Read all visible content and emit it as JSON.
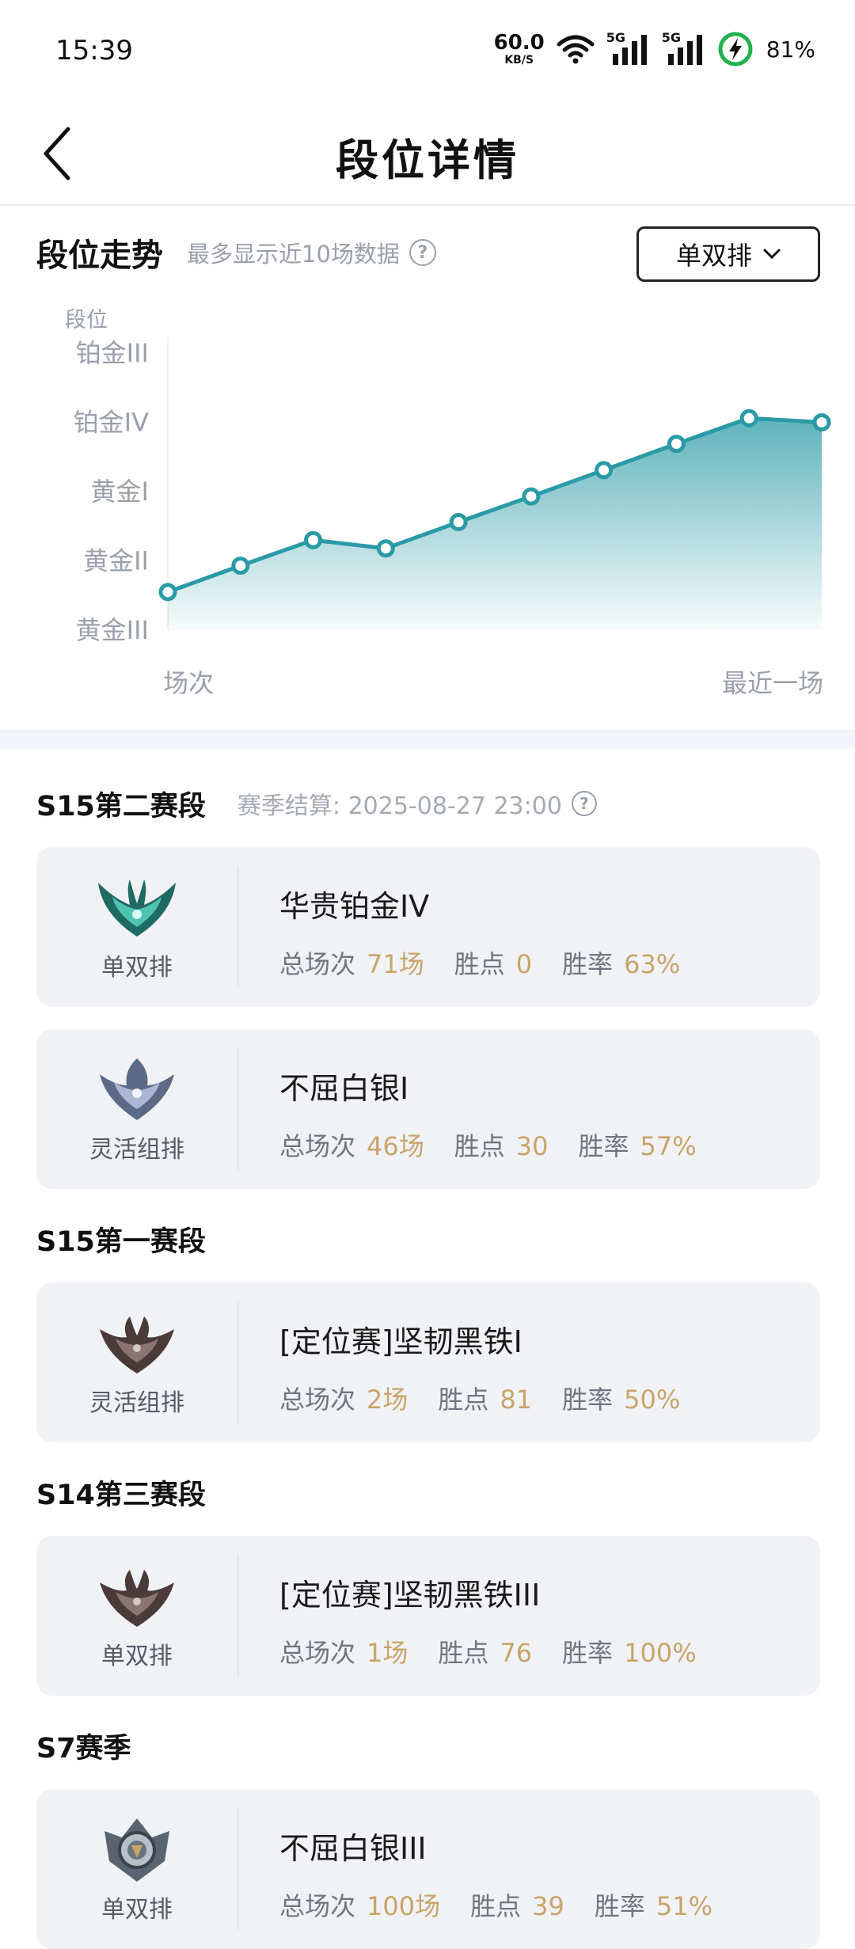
{
  "status_bar": {
    "time": "15:39",
    "net_speed_value": "60.0",
    "net_speed_unit": "KB/S",
    "signal_1_label": "5G",
    "signal_2_label": "5G",
    "battery_percent": "81%"
  },
  "nav": {
    "title": "段位详情"
  },
  "trend": {
    "title": "段位走势",
    "hint": "最多显示近10场数据",
    "help": "?",
    "queue_selected": "单双排"
  },
  "chart_data": {
    "type": "area",
    "ylabel": "段位",
    "xlabel_start": "场次",
    "xlabel_end": "最近一场",
    "y_ticks": [
      "黄金III",
      "黄金II",
      "黄金I",
      "铂金IV",
      "铂金III"
    ],
    "ylim": [
      0,
      4
    ],
    "x": [
      1,
      2,
      3,
      4,
      5,
      6,
      7,
      8,
      9,
      10
    ],
    "values": [
      0.55,
      0.93,
      1.3,
      1.18,
      1.56,
      1.93,
      2.31,
      2.69,
      3.06,
      3.0
    ],
    "color": "#2a9aa6",
    "grid": false
  },
  "seasons": [
    {
      "name": "S15第二赛段",
      "settle_text": "赛季结算: 2025-08-27 23:00",
      "help": "?",
      "ranks": [
        {
          "queue": "单双排",
          "rank": "华贵铂金IV",
          "games_label": "总场次",
          "games": "71场",
          "lp_label": "胜点",
          "lp": "0",
          "wr_label": "胜率",
          "wr": "63%",
          "emblem": "platinum-emblem-icon"
        },
        {
          "queue": "灵活组排",
          "rank": "不屈白银I",
          "games_label": "总场次",
          "games": "46场",
          "lp_label": "胜点",
          "lp": "30",
          "wr_label": "胜率",
          "wr": "57%",
          "emblem": "silver-emblem-icon"
        }
      ]
    },
    {
      "name": "S15第一赛段",
      "ranks": [
        {
          "queue": "灵活组排",
          "rank": "[定位赛]坚韧黑铁I",
          "games_label": "总场次",
          "games": "2场",
          "lp_label": "胜点",
          "lp": "81",
          "wr_label": "胜率",
          "wr": "50%",
          "emblem": "iron-emblem-icon"
        }
      ]
    },
    {
      "name": "S14第三赛段",
      "ranks": [
        {
          "queue": "单双排",
          "rank": "[定位赛]坚韧黑铁III",
          "games_label": "总场次",
          "games": "1场",
          "lp_label": "胜点",
          "lp": "76",
          "wr_label": "胜率",
          "wr": "100%",
          "emblem": "iron-emblem-icon"
        }
      ]
    },
    {
      "name": "S7赛季",
      "ranks": [
        {
          "queue": "单双排",
          "rank": "不屈白银III",
          "games_label": "总场次",
          "games": "100场",
          "lp_label": "胜点",
          "lp": "39",
          "wr_label": "胜率",
          "wr": "51%",
          "emblem": "silver-old-emblem-icon"
        }
      ]
    }
  ]
}
